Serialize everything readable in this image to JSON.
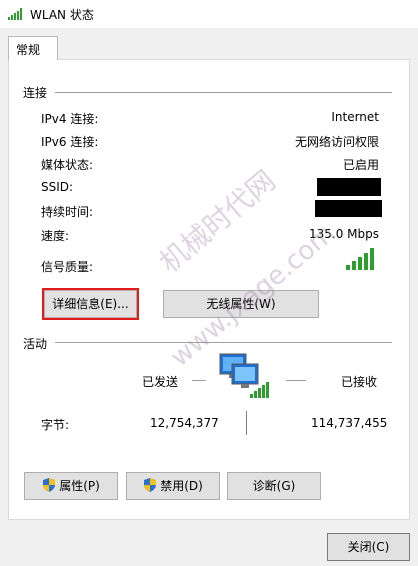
{
  "window": {
    "title": "WLAN 状态"
  },
  "tabs": [
    {
      "label": "常规"
    }
  ],
  "connection": {
    "section_label": "连接",
    "rows": [
      {
        "label": "IPv4 连接:",
        "value": "Internet"
      },
      {
        "label": "IPv6 连接:",
        "value": "无网络访问权限"
      },
      {
        "label": "媒体状态:",
        "value": "已启用"
      },
      {
        "label": "SSID:",
        "value": ""
      },
      {
        "label": "持续时间:",
        "value": ""
      },
      {
        "label": "速度:",
        "value": "135.0 Mbps"
      },
      {
        "label": "信号质量:",
        "value": ""
      }
    ],
    "details_button": "详细信息(E)...",
    "wireless_props_button": "无线属性(W)"
  },
  "activity": {
    "section_label": "活动",
    "sent_label": "已发送",
    "received_label": "已接收",
    "bytes_label": "字节:",
    "bytes_sent": "12,754,377",
    "bytes_received": "114,737,455"
  },
  "actions": {
    "properties_button": "属性(P)",
    "disable_button": "禁用(D)",
    "diagnose_button": "诊断(G)"
  },
  "footer": {
    "close_button": "关闭(C)"
  },
  "watermark": {
    "text1": "机械时代网",
    "text2": "www.jxage.com"
  },
  "signal_strength_bars": 5,
  "colors": {
    "signal_green": "#2e9e2e",
    "highlight_red": "#e31b1b",
    "shield_blue": "#2d6fd1",
    "shield_yellow": "#f2c21b"
  }
}
